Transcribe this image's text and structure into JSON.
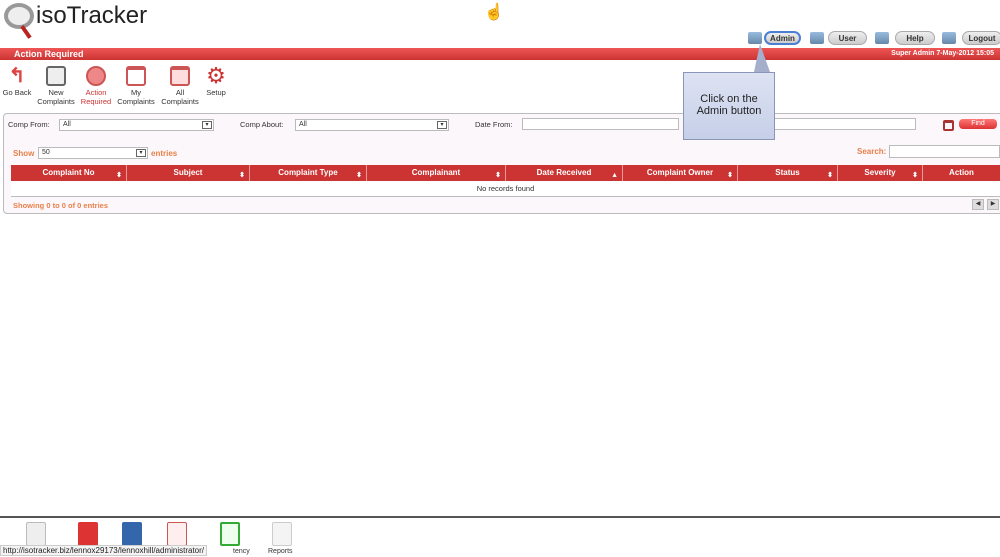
{
  "app": {
    "logo": "isoTracker"
  },
  "top_nav": [
    {
      "label": "Admin",
      "icon": "admin-icon"
    },
    {
      "label": "User",
      "icon": "user-icon"
    },
    {
      "label": "Help",
      "icon": "help-icon"
    },
    {
      "label": "Logout",
      "icon": "logout-icon"
    }
  ],
  "header": {
    "title": "Action Required",
    "user_info": "Super Admin  7-May-2012 15:05"
  },
  "toolbar": [
    {
      "label": "Go Back",
      "icon": "back-arrow-icon"
    },
    {
      "label": "New Complaints",
      "icon": "edit-icon"
    },
    {
      "label": "Action Required",
      "icon": "stopwatch-icon"
    },
    {
      "label": "My Complaints",
      "icon": "window-icon"
    },
    {
      "label": "All Complaints",
      "icon": "windows-icon"
    },
    {
      "label": "Setup",
      "icon": "gear-icon"
    }
  ],
  "filters": {
    "comp_from_label": "Comp From:",
    "comp_from_value": "All",
    "comp_about_label": "Comp About:",
    "comp_about_value": "All",
    "date_from_label": "Date From:",
    "date_from_value": "",
    "date_to_value": "",
    "find_label": "Find"
  },
  "table": {
    "show_label": "Show",
    "show_value": "50",
    "entries_label": "entries",
    "search_label": "Search:",
    "search_value": "",
    "columns": [
      "Complaint No",
      "Subject",
      "Complaint Type",
      "Complainant",
      "Date Received",
      "Complaint Owner",
      "Status",
      "Severity",
      "Action"
    ],
    "empty_text": "No records found",
    "info": "Showing 0 to 0 of 0 entries"
  },
  "callout": {
    "text": "Click on the Admin button"
  },
  "bottom_bar": {
    "items": [
      "tency",
      "Reports"
    ],
    "status_url": "http://isotracker.biz/lennox29173/lennoxhill/administrator/"
  },
  "colors": {
    "accent": "#cc3333",
    "orange": "#e8804a"
  }
}
